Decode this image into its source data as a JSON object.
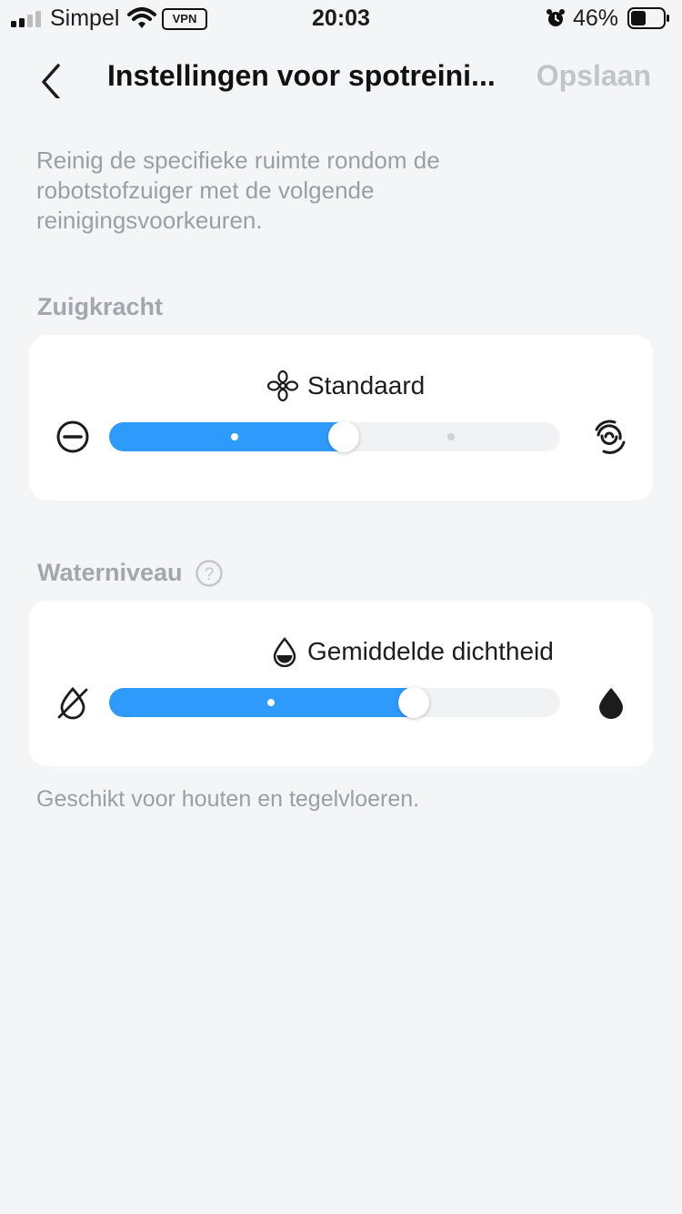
{
  "status_bar": {
    "carrier": "Simpel",
    "vpn": "VPN",
    "time": "20:03",
    "battery_percent": "46%",
    "battery_level": 0.46
  },
  "nav": {
    "title": "Instellingen voor spotreini...",
    "save_label": "Opslaan"
  },
  "description": "Reinig de specifieke ruimte rondom de robotstofzuiger met de volgende reinigingsvoorkeuren.",
  "suction": {
    "label": "Zuigkracht",
    "mode": "Standaard",
    "level": 0.52,
    "min_icon": "quiet-minus-icon",
    "max_icon": "max-swirl-icon",
    "mode_icon": "fan-icon"
  },
  "water": {
    "label": "Waterniveau",
    "mode": "Gemiddelde dichtheid",
    "level": 0.675,
    "min_icon": "no-water-icon",
    "max_icon": "water-drop-filled-icon",
    "mode_icon": "water-drop-half-icon"
  },
  "hint": "Geschikt voor houten en tegelvloeren.",
  "colors": {
    "accent": "#2e9bfc",
    "background": "#f4f5f7",
    "muted_text": "#9a9ea5"
  }
}
